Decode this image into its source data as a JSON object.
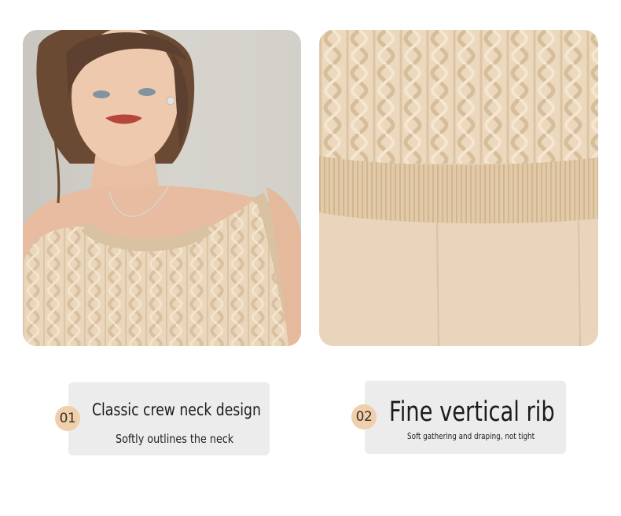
{
  "colors": {
    "badge_background": "#efcfac",
    "card_background": "#ececec",
    "knit_color": "#e6d1b6"
  },
  "features": [
    {
      "number": "01",
      "title": "Classic crew neck design",
      "subtitle": "Softly outlines the neck"
    },
    {
      "number": "02",
      "title": "Fine vertical rib",
      "subtitle": "Soft gathering and draping, not tight"
    }
  ]
}
